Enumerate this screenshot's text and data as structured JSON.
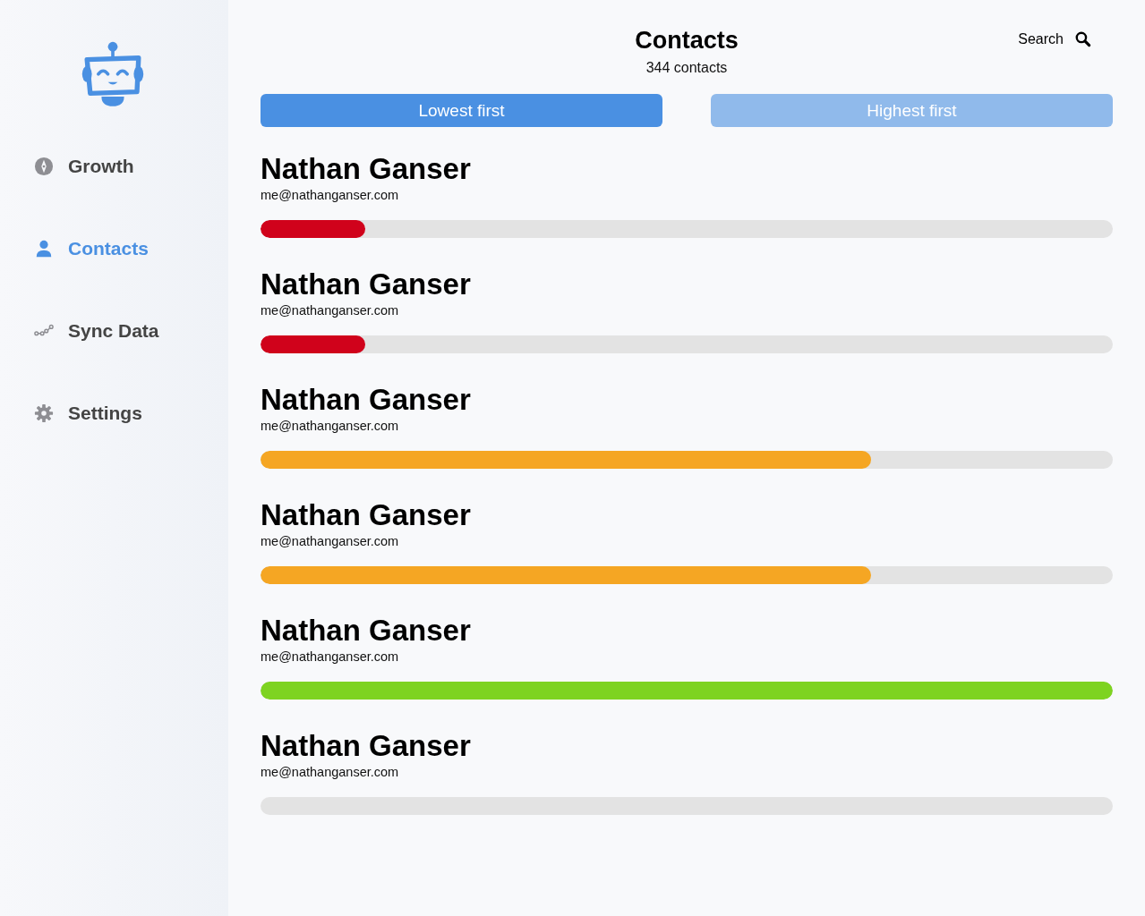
{
  "sidebar": {
    "items": [
      {
        "label": "Growth",
        "selected": false
      },
      {
        "label": "Contacts",
        "selected": true
      },
      {
        "label": "Sync Data",
        "selected": false
      },
      {
        "label": "Settings",
        "selected": false
      }
    ]
  },
  "header": {
    "title": "Contacts",
    "subtitle": "344 contacts",
    "search": "Search"
  },
  "sort_buttons": [
    {
      "label": "Lowest first",
      "selected": true
    },
    {
      "label": "Highest first",
      "selected": false
    }
  ],
  "contacts": [
    {
      "name": "Nathan Ganser",
      "email": "me@nathanganser.com",
      "level": 0.123,
      "color": "#d0021b"
    },
    {
      "name": "Nathan Ganser",
      "email": "me@nathanganser.com",
      "level": 0.123,
      "color": "#d0021b"
    },
    {
      "name": "Nathan Ganser",
      "email": "me@nathanganser.com",
      "level": 0.716,
      "color": "#f5a623"
    },
    {
      "name": "Nathan Ganser",
      "email": "me@nathanganser.com",
      "level": 0.716,
      "color": "#f5a623"
    },
    {
      "name": "Nathan Ganser",
      "email": "me@nathanganser.com",
      "level": 1,
      "color": "#7ed321"
    },
    {
      "name": "Nathan Ganser",
      "email": "me@nathanganser.com",
      "level": 0
    }
  ]
}
